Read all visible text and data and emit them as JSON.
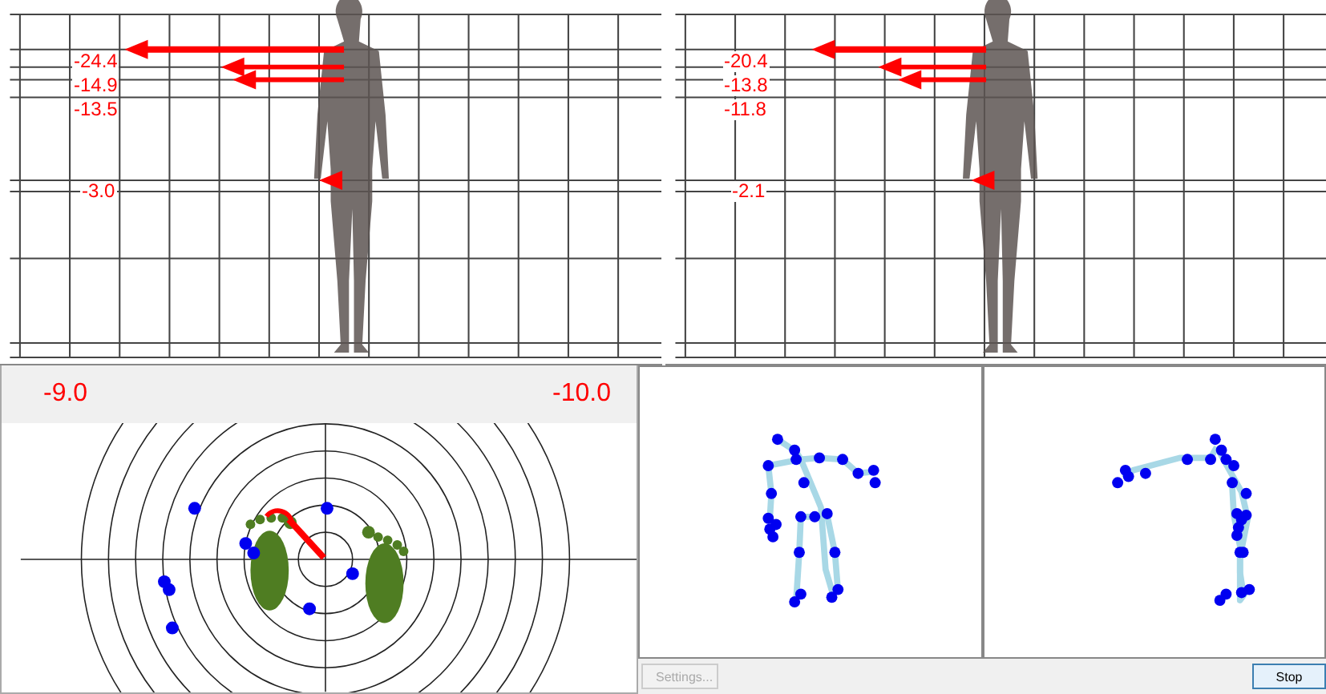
{
  "front_view": {
    "readings": [
      "-24.4",
      "-14.9",
      "-13.5",
      "-3.0"
    ]
  },
  "side_view": {
    "readings": [
      "-20.4",
      "-13.8",
      "-11.8",
      "-2.1"
    ]
  },
  "balance": {
    "left_reading": "-9.0",
    "right_reading": "-10.0"
  },
  "buttons": [
    {
      "label": "Settings...",
      "disabled": true
    },
    {
      "label": "Stop",
      "disabled": false
    }
  ]
}
